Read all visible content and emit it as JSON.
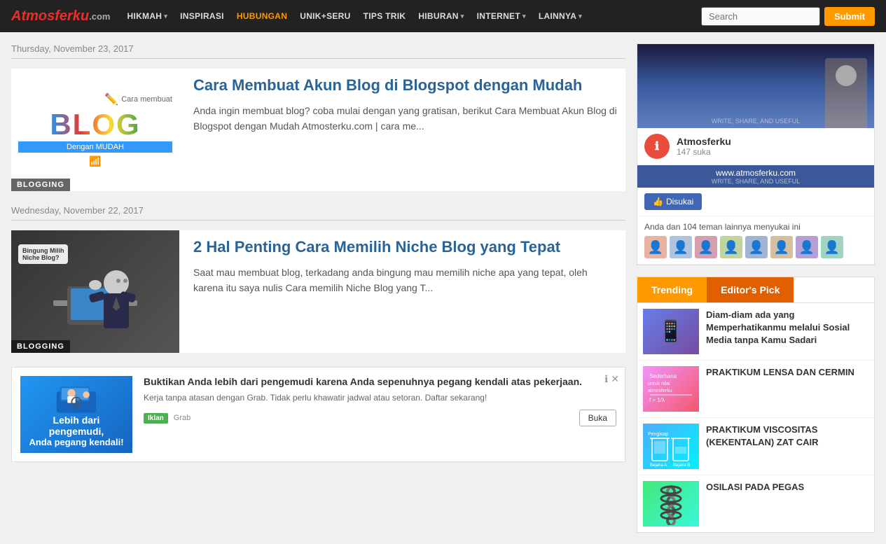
{
  "site": {
    "logo": "Atmosferku",
    "logo_part1": "Atmosferku",
    "logo_part2": ".com"
  },
  "header": {
    "nav": [
      {
        "label": "HIKMAH",
        "has_arrow": true,
        "active": false
      },
      {
        "label": "INSPIRASI",
        "has_arrow": false,
        "active": false
      },
      {
        "label": "HUBUNGAN",
        "has_arrow": false,
        "active": true
      },
      {
        "label": "UNIK+SERU",
        "has_arrow": false,
        "active": false
      },
      {
        "label": "TIPS TRIK",
        "has_arrow": false,
        "active": false
      },
      {
        "label": "HIBURAN",
        "has_arrow": true,
        "active": false
      },
      {
        "label": "INTERNET",
        "has_arrow": true,
        "active": false
      },
      {
        "label": "LAINNYA",
        "has_arrow": true,
        "active": false
      }
    ],
    "search_placeholder": "Search",
    "submit_label": "Submit"
  },
  "content": {
    "date1": "Thursday, November 23, 2017",
    "date2": "Wednesday, November 22, 2017",
    "post1": {
      "title": "Cara Membuat Akun Blog di Blogspot dengan Mudah",
      "excerpt": "Anda ingin membuat blog? coba mulai dengan yang gratisan, berikut Cara Membuat Akun Blog di Blogspot dengan Mudah Atmosterku.com | cara me...",
      "badge": "BLOGGING"
    },
    "post2": {
      "title": "2 Hal Penting Cara Memilih Niche Blog yang Tepat",
      "excerpt": "Saat mau membuat blog, terkadang anda bingung mau memilih niche apa yang tepat, oleh karena itu saya nulis Cara memilih Niche Blog yang T...",
      "badge": "BLOGGING"
    },
    "ad": {
      "left_text1": "Lebih dari pengemudi,",
      "left_text2": "Anda pegang kendali!",
      "title": "Buktikan Anda lebih dari pengemudi karena Anda sepenuhnya pegang kendali atas pekerjaan.",
      "desc": "Kerja tanpa atasan dengan Grab. Tidak perlu khawatir jadwal atau setoran. Daftar sekarang!",
      "badge": "Iklan",
      "brand": "Grab",
      "open_label": "Buka"
    }
  },
  "sidebar": {
    "fb": {
      "page_name": "Atmosferku",
      "likes": "147 suka",
      "url": "www.atmosferku.com",
      "tagline": "WRITE, SHARE, AND USEFUL",
      "like_btn": "Disukai",
      "friends_text": "Anda dan 104 teman lainnya menyukai ini"
    },
    "trending": {
      "tab1": "Trending",
      "tab2": "Editor's Pick",
      "items": [
        {
          "text": "Diam-diam ada yang Memperhatikanmu melalui Sosial Media tanpa Kamu Sadari",
          "thumb_class": "t1",
          "icon": "📱"
        },
        {
          "text": "PRAKTIKUM LENSA DAN CERMIN",
          "thumb_class": "t2",
          "icon": "🔬"
        },
        {
          "text": "PRAKTIKUM VISCOSITAS (KEKENTALAN) ZAT CAIR",
          "thumb_class": "t3",
          "icon": "🧪"
        },
        {
          "text": "OSILASI PADA PEGAS",
          "thumb_class": "t4",
          "icon": "🔩"
        }
      ]
    }
  }
}
